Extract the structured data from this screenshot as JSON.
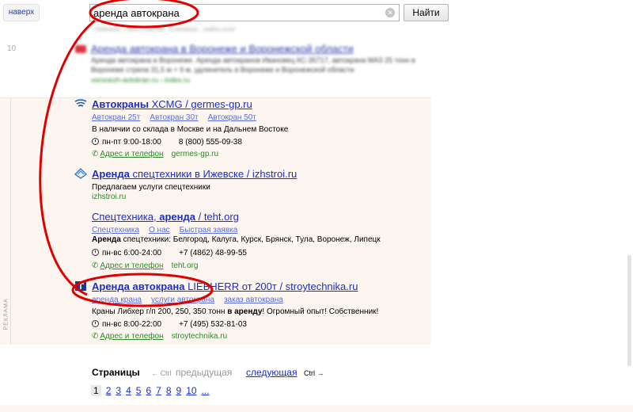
{
  "topbar": {
    "up_label": "наверх",
    "search_value": "аренда автокрана",
    "find_label": "Найти",
    "clear_glyph": "✕",
    "blur_strip": "Найдено 2 млн ответов · в регионе · найти ещё"
  },
  "organic": {
    "number": "10",
    "title": "Аренда автокрана в Воронеже и Воронежской области",
    "snippet1": "Аренда автокрана в Воронеже. Аренда автокранов Ивановец КС-35717, автокрана МАЗ 25 тонн в",
    "snippet2": "Воронеже стрела 31,5 м + 9 м, удлинитель в Воронеже и Воронежской области",
    "url": "voronezh-avtokran.ru › index.ru"
  },
  "ads_label": "РЕКЛАМА",
  "ads": [
    {
      "title_bold": "Автокраны",
      "title_rest": " XCMG / germes-gp.ru",
      "sitelinks": [
        "Автокран 25т",
        "Автокран 30т",
        "Автокран 50т"
      ],
      "text": "В наличии со склада в Москве и на Дальнем Востоке",
      "hours": "пн-пт 9:00-18:00",
      "phone": "8 (800) 555-09-38",
      "contact_label": "Адрес и телефон",
      "domain": "germes-gp.ru"
    },
    {
      "title_bold": "Аренда",
      "title_rest": " спецтехники в Ижевске / izhstroi.ru",
      "text": "Предлагаем услуги спецтехники",
      "domain": "izhstroi.ru"
    },
    {
      "title_pre": "Спецтехника, ",
      "title_bold": "аренда",
      "title_rest": " / teht.org",
      "sitelinks": [
        "Спецтехника",
        "О нас",
        "Быстрая заявка"
      ],
      "text_bold": "Аренда",
      "text_rest": " спецтехники: Белгород, Калуга, Курск, Брянск, Тула, Воронеж, Липецк",
      "hours": "пн-вс 6:00-24:00",
      "phone": "+7 (4862) 48-99-55",
      "contact_label": "Адрес и телефон",
      "domain": "teht.org"
    },
    {
      "title_bold": "Аренда автокрана",
      "title_rest": " LIEBHERR от 200т / stroytechnika.ru",
      "sitelinks": [
        "аренда крана",
        "услуги автокрана",
        "заказ автокрана"
      ],
      "text_pre": "Краны Либхер г/п 200, 250, 350 тонн ",
      "text_bold": "в аренду",
      "text_rest": "! Огромный опыт! Собственник!",
      "hours": "пн-вс 8:00-22:00",
      "phone": "+7 (495) 532-81-03",
      "contact_label": "Адрес и телефон",
      "domain": "stroytechnika.ru"
    }
  ],
  "pager": {
    "label": "Страницы",
    "prev_hint": "← Ctrl",
    "prev": "предыдущая",
    "next": "следующая",
    "next_hint": "Ctrl →",
    "pages": [
      "1",
      "2",
      "3",
      "4",
      "5",
      "6",
      "7",
      "8",
      "9",
      "10",
      "..."
    ]
  },
  "colors": {
    "link": "#1a2dd0",
    "green": "#2c8a2c",
    "ads_bg": "#fdf5ef",
    "annotation": "#e00000"
  }
}
